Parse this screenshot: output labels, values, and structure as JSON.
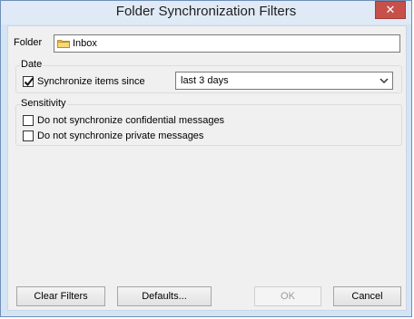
{
  "window": {
    "title": "Folder Synchronization Filters",
    "close_glyph": "✕"
  },
  "folder": {
    "label": "Folder",
    "value": "Inbox",
    "icon": "folder-icon"
  },
  "date_group": {
    "title": "Date",
    "sync_since": {
      "label": "Synchronize items since",
      "checked": true
    },
    "range_select": {
      "value": "last 3 days"
    }
  },
  "sensitivity_group": {
    "title": "Sensitivity",
    "no_confidential": {
      "label": "Do not synchronize confidential messages",
      "checked": false
    },
    "no_private": {
      "label": "Do not synchronize private messages",
      "checked": false
    }
  },
  "buttons": {
    "clear_filters": "Clear Filters",
    "defaults": "Defaults...",
    "ok": "OK",
    "cancel": "Cancel"
  },
  "colors": {
    "frame": "#d5e4f5",
    "close": "#c7504a",
    "client": "#f0f0f0"
  }
}
